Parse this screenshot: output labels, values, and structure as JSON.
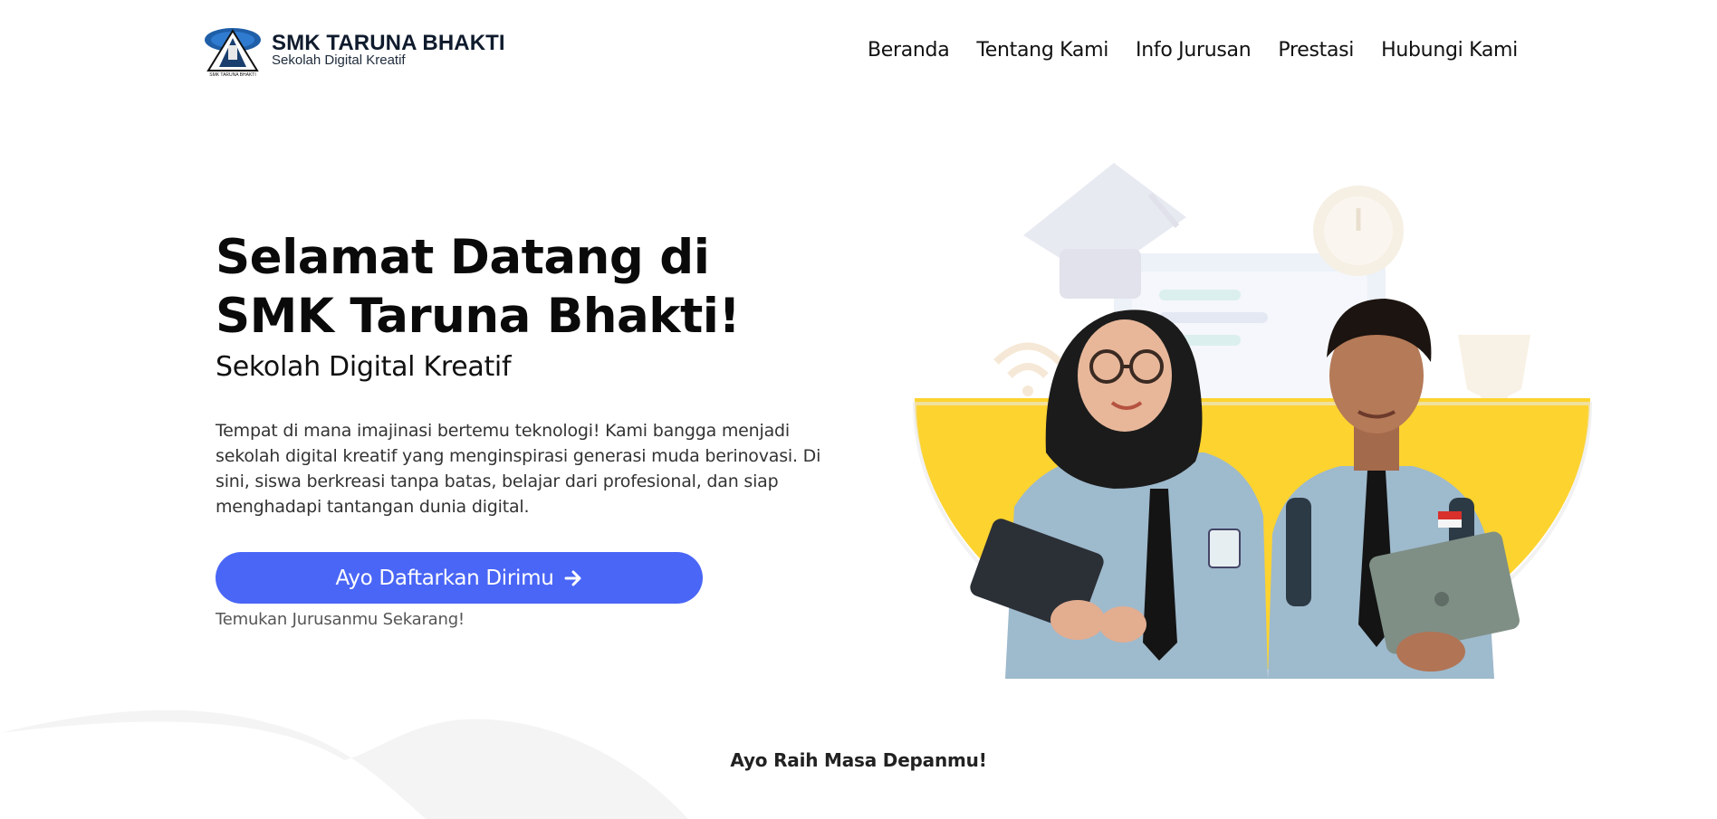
{
  "brand": {
    "name": "SMK TARUNA BHAKTI",
    "tagline": "Sekolah Digital Kreatif",
    "logo_caption": "SMK TARUNA BHAKTI"
  },
  "nav": {
    "items": [
      {
        "label": "Beranda"
      },
      {
        "label": "Tentang Kami"
      },
      {
        "label": "Info Jurusan"
      },
      {
        "label": "Prestasi"
      },
      {
        "label": "Hubungi Kami"
      }
    ]
  },
  "hero": {
    "title_line1": "Selamat Datang di",
    "title_line2": "SMK Taruna Bhakti!",
    "subtitle": "Sekolah Digital Kreatif",
    "description": "Tempat di mana imajinasi bertemu teknologi! Kami bangga menjadi sekolah digital kreatif yang menginspirasi generasi muda berinovasi. Di sini, siswa berkreasi tanpa batas, belajar dari profesional, dan siap menghadapi tantangan dunia digital.",
    "cta_label": "Ayo Daftarkan Dirimu",
    "cta_hint": "Temukan Jurusanmu Sekarang!",
    "image_alt": "students-illustration"
  },
  "footer_tagline": "Ayo Raih Masa Depanmu!",
  "colors": {
    "accent": "#4a66f6",
    "yellow": "#fdd32f",
    "wave": "#f3f3f3"
  }
}
